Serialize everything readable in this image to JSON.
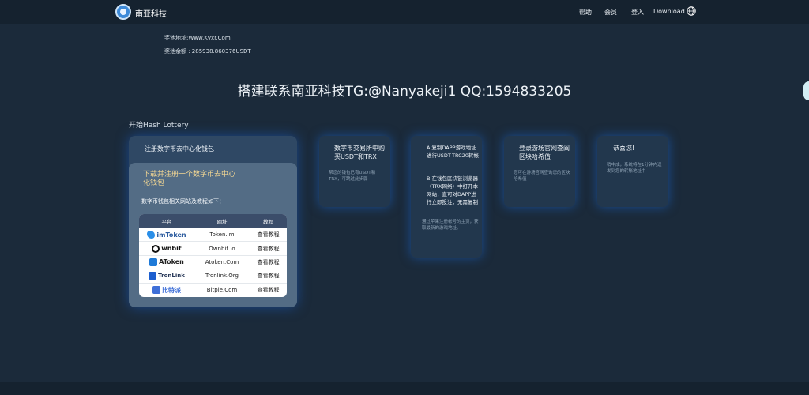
{
  "nav": {
    "brand": "南亚科技",
    "items": [
      "帮助",
      "会员",
      "登入",
      "Download"
    ]
  },
  "award": {
    "address": "奖池地址:Www.Kvxr.Com",
    "balance": "奖池余额 : 285938.860376USDT"
  },
  "headline": "搭建联系南亚科技TG:@Nanyakeji1 QQ:1594833205",
  "section_title": "开始Hash Lottery",
  "step1": {
    "title": "注册数字币去中心化钱包",
    "inner_title": "下载并注册一个数字币去中心化钱包",
    "inner_sub": "数字币钱包相关网站及教程如下：",
    "headers": [
      "平台",
      "网址",
      "教程"
    ],
    "rows": [
      {
        "name": "imToken",
        "url": "Token.Im",
        "tutorial": "查看教程"
      },
      {
        "name": "wnbit",
        "url": "Ownbit.Io",
        "tutorial": "查看教程"
      },
      {
        "name": "AToken",
        "url": "Atoken.Com",
        "tutorial": "查看教程"
      },
      {
        "name": "TronLink",
        "url": "Tronlink.Org",
        "tutorial": "查看教程"
      },
      {
        "name": "比特派",
        "url": "Bitpie.Com",
        "tutorial": "查看教程"
      }
    ]
  },
  "steps": [
    {
      "title": "数字币交易所中购买USDT和TRX",
      "desc": "帮您的钱包已有USDT和TRX，可跳过此步骤"
    },
    {
      "title": "A.复制DAPP游戏地址进行USDT-TRC20转帐",
      "title2": "B.在钱包区块链浏览器（TRX网络）中打开本网站，直可对DAPP进行立即投注，无需复制",
      "desc": "通过苹果注册帐号的主页，获取最新的游戏地址。"
    },
    {
      "title": "登录游场官网查阅区块哈希值",
      "desc": "您可在游场官网查询您的区块哈希值"
    },
    {
      "title": "恭喜您!",
      "desc": "稍中成，系统将在1分钟内送发到您的转账地址中"
    }
  ],
  "colors": {
    "background": "#1b2a3a",
    "card": "#22374d",
    "glow": "#1e6edc",
    "inner_title": "#f2d693"
  }
}
